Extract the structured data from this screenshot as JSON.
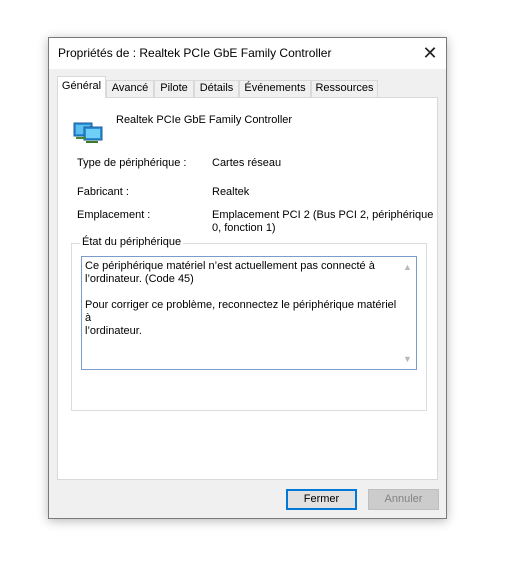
{
  "dialog": {
    "title": "Propriétés de : Realtek PCIe GbE Family Controller",
    "close_glyph": "✕"
  },
  "tabs": [
    {
      "label": "Général",
      "active": true
    },
    {
      "label": "Avancé"
    },
    {
      "label": "Pilote"
    },
    {
      "label": "Détails"
    },
    {
      "label": "Événements"
    },
    {
      "label": "Ressources"
    }
  ],
  "device": {
    "name": "Realtek PCIe GbE Family Controller",
    "icon": "network-adapter-icon"
  },
  "props": {
    "type_label": "Type de périphérique :",
    "type_value": "Cartes réseau",
    "manufacturer_label": "Fabricant :",
    "manufacturer_value": "Realtek",
    "location_label": "Emplacement :",
    "location_value_line1": "Emplacement PCI 2 (Bus PCI 2, périphérique",
    "location_value_line2": "0, fonction 1)"
  },
  "status": {
    "legend": "État du périphérique",
    "line1": "Ce périphérique matériel n’est actuellement pas connecté à",
    "line2": "l’ordinateur.  (Code 45)",
    "line3": "Pour corriger ce problème, reconnectez le périphérique matériel à",
    "line4": "l’ordinateur."
  },
  "buttons": {
    "close_label": "Fermer",
    "cancel_label": "Annuler"
  },
  "colors": {
    "focus_blue": "#0078d7",
    "status_border": "#7a9cc8"
  }
}
